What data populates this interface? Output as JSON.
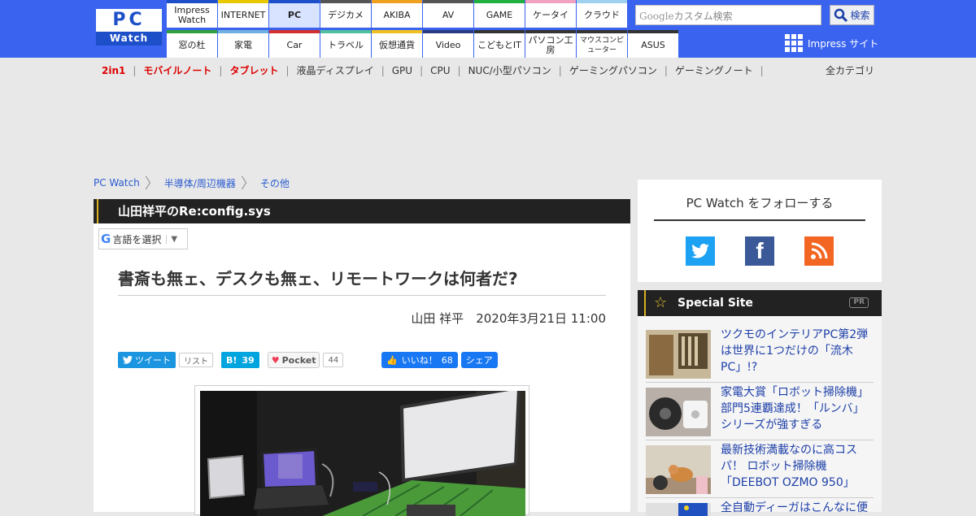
{
  "logo": {
    "pc": "PC",
    "watch": "Watch"
  },
  "nav": {
    "row1": [
      {
        "label": "Impress Watch",
        "color": "#1d4fc8"
      },
      {
        "label": "INTERNET",
        "color": "#e8c800"
      },
      {
        "label": "PC",
        "color": "#1d4fc8",
        "active": true
      },
      {
        "label": "デジカメ",
        "color": "#555555"
      },
      {
        "label": "AKIBA",
        "color": "#f0a020"
      },
      {
        "label": "AV",
        "color": "#555555"
      },
      {
        "label": "GAME",
        "color": "#20b040"
      },
      {
        "label": "ケータイ",
        "color": "#f0a0c0"
      },
      {
        "label": "クラウド",
        "color": "#a0d0f0"
      }
    ],
    "row2": [
      {
        "label": "窓の杜",
        "color": "#30a040"
      },
      {
        "label": "家電",
        "color": "#70b0e0"
      },
      {
        "label": "Car",
        "color": "#d03030"
      },
      {
        "label": "トラベル",
        "color": "#50c0a0"
      },
      {
        "label": "仮想通貨",
        "color": "#f0c020"
      },
      {
        "label": "Video",
        "color": "#2a3a80"
      },
      {
        "label": "こどもとIT",
        "color": "#333333"
      },
      {
        "label": "パソコン工房",
        "color": "#333333"
      },
      {
        "label": "マウスコンピューター",
        "color": "#333333"
      },
      {
        "label": "ASUS",
        "color": "#333333"
      }
    ]
  },
  "search": {
    "google": "Google",
    "placeholder": "カスタム検索",
    "button": "検索"
  },
  "impress_site": "Impress サイト",
  "categories": [
    "2in1",
    "モバイルノート",
    "タブレット",
    "液晶ディスプレイ",
    "GPU",
    "CPU",
    "NUC/小型パソコン",
    "ゲーミングパソコン",
    "ゲーミングノート"
  ],
  "all_categories": "全カテゴリ",
  "breadcrumb": [
    "PC Watch",
    "半導体/周辺機器",
    "その他"
  ],
  "article": {
    "series": "山田祥平のRe:config.sys",
    "language_select": "言語を選択",
    "title": "書斎も無ェ、デスクも無ェ、リモートワークは何者だ?",
    "author": "山田 祥平",
    "date": "2020年3月21日 11:00"
  },
  "social": {
    "tweet": "ツイート",
    "list": "リスト",
    "hatena": "B!",
    "hatena_count": "39",
    "pocket": "Pocket",
    "pocket_count": "44",
    "like": "いいね！",
    "like_count": "68",
    "share": "シェア"
  },
  "sidebar": {
    "follow_title": "PC Watch をフォローする",
    "special_title": "Special Site",
    "pr": "PR",
    "items": [
      {
        "text": "ツクモのインテリアPC第2弾は世界に1つだけの「流木PC」!?"
      },
      {
        "text": "家電大賞「ロボット掃除機」部門5連覇達成！「ルンバ」シリーズが強すぎる"
      },
      {
        "text": "最新技術満載なのに高コスパ！ ロボット掃除機「DEEBOT OZMO 950」"
      },
      {
        "text": "全自動ディーガはこんなに便"
      }
    ]
  },
  "colors": {
    "brand": "#3a63f0",
    "link": "#2a5ad0",
    "red": "#dd0000"
  }
}
